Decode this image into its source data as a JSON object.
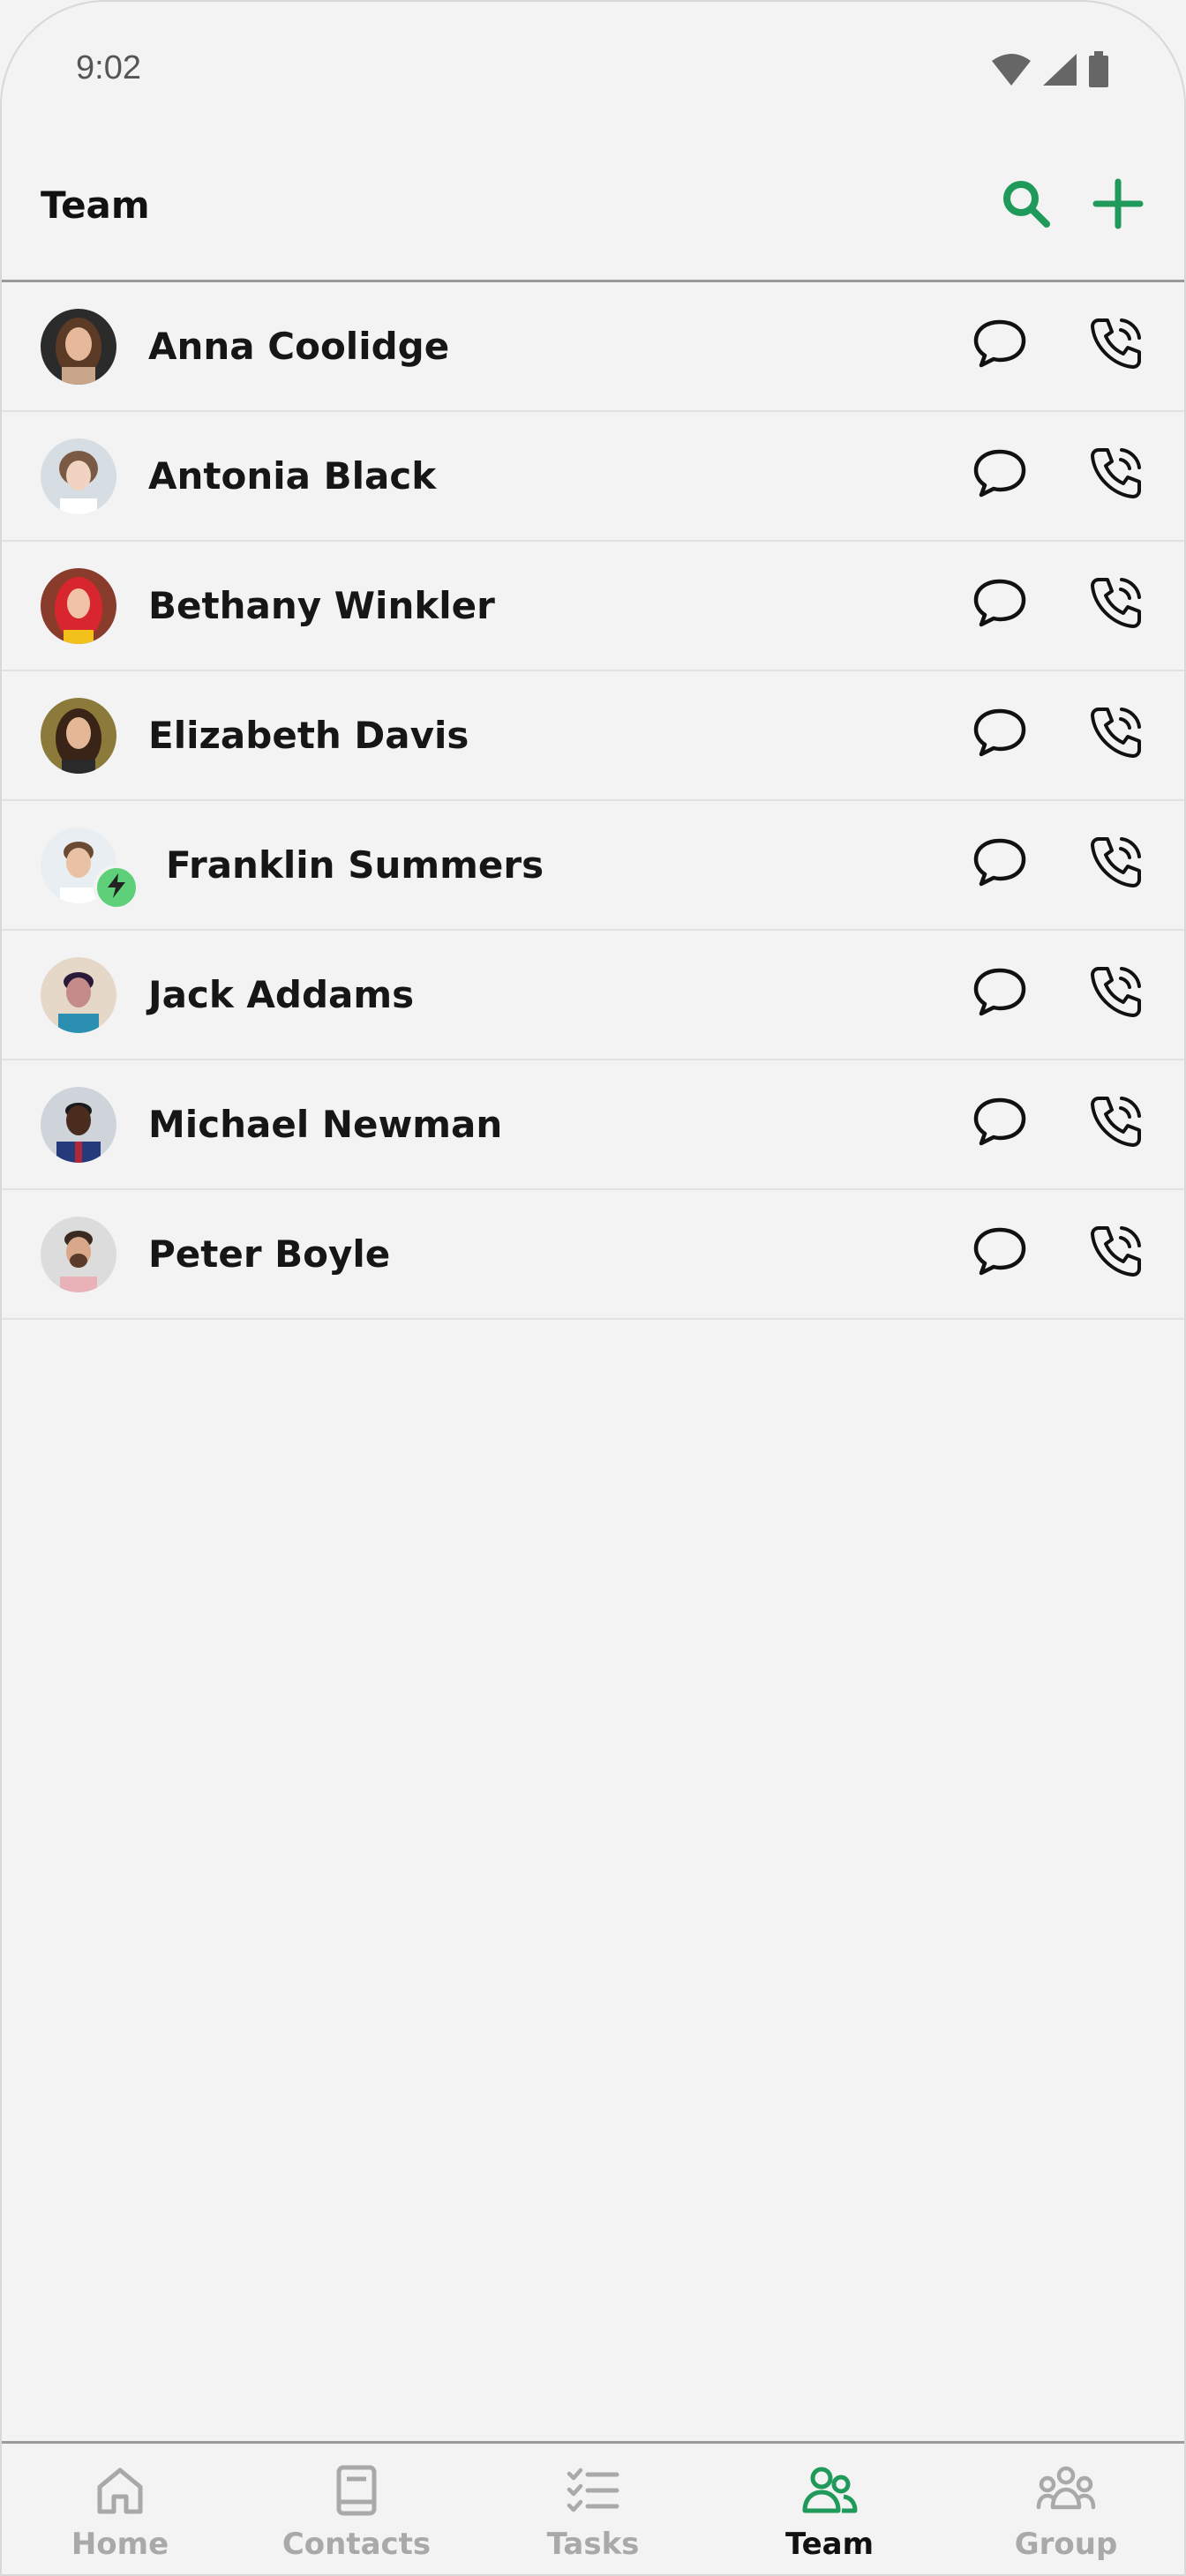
{
  "status_bar": {
    "time": "9:02",
    "icons": [
      "wifi-icon",
      "signal-icon",
      "battery-icon"
    ]
  },
  "header": {
    "title": "Team",
    "actions": [
      "search-icon",
      "plus-icon"
    ]
  },
  "colors": {
    "accent": "#1f9a5a",
    "badge": "#5fd07a",
    "inactive": "#a9a9a9",
    "background": "#f3f3f3"
  },
  "team": [
    {
      "name": "Anna Coolidge"
    },
    {
      "name": "Antonia Black"
    },
    {
      "name": "Bethany Winkler"
    },
    {
      "name": "Elizabeth Davis"
    },
    {
      "name": "Franklin Summers",
      "badge": "lightning-icon"
    },
    {
      "name": "Jack Addams"
    },
    {
      "name": "Michael Newman"
    },
    {
      "name": "Peter Boyle"
    }
  ],
  "row_actions": [
    "chat-bubble-icon",
    "phone-call-icon"
  ],
  "nav": {
    "items": [
      {
        "label": "Home",
        "icon": "home-icon",
        "active": false
      },
      {
        "label": "Contacts",
        "icon": "contacts-book-icon",
        "active": false
      },
      {
        "label": "Tasks",
        "icon": "tasks-checklist-icon",
        "active": false
      },
      {
        "label": "Team",
        "icon": "team-icon",
        "active": true
      },
      {
        "label": "Group",
        "icon": "group-icon",
        "active": false
      }
    ]
  }
}
